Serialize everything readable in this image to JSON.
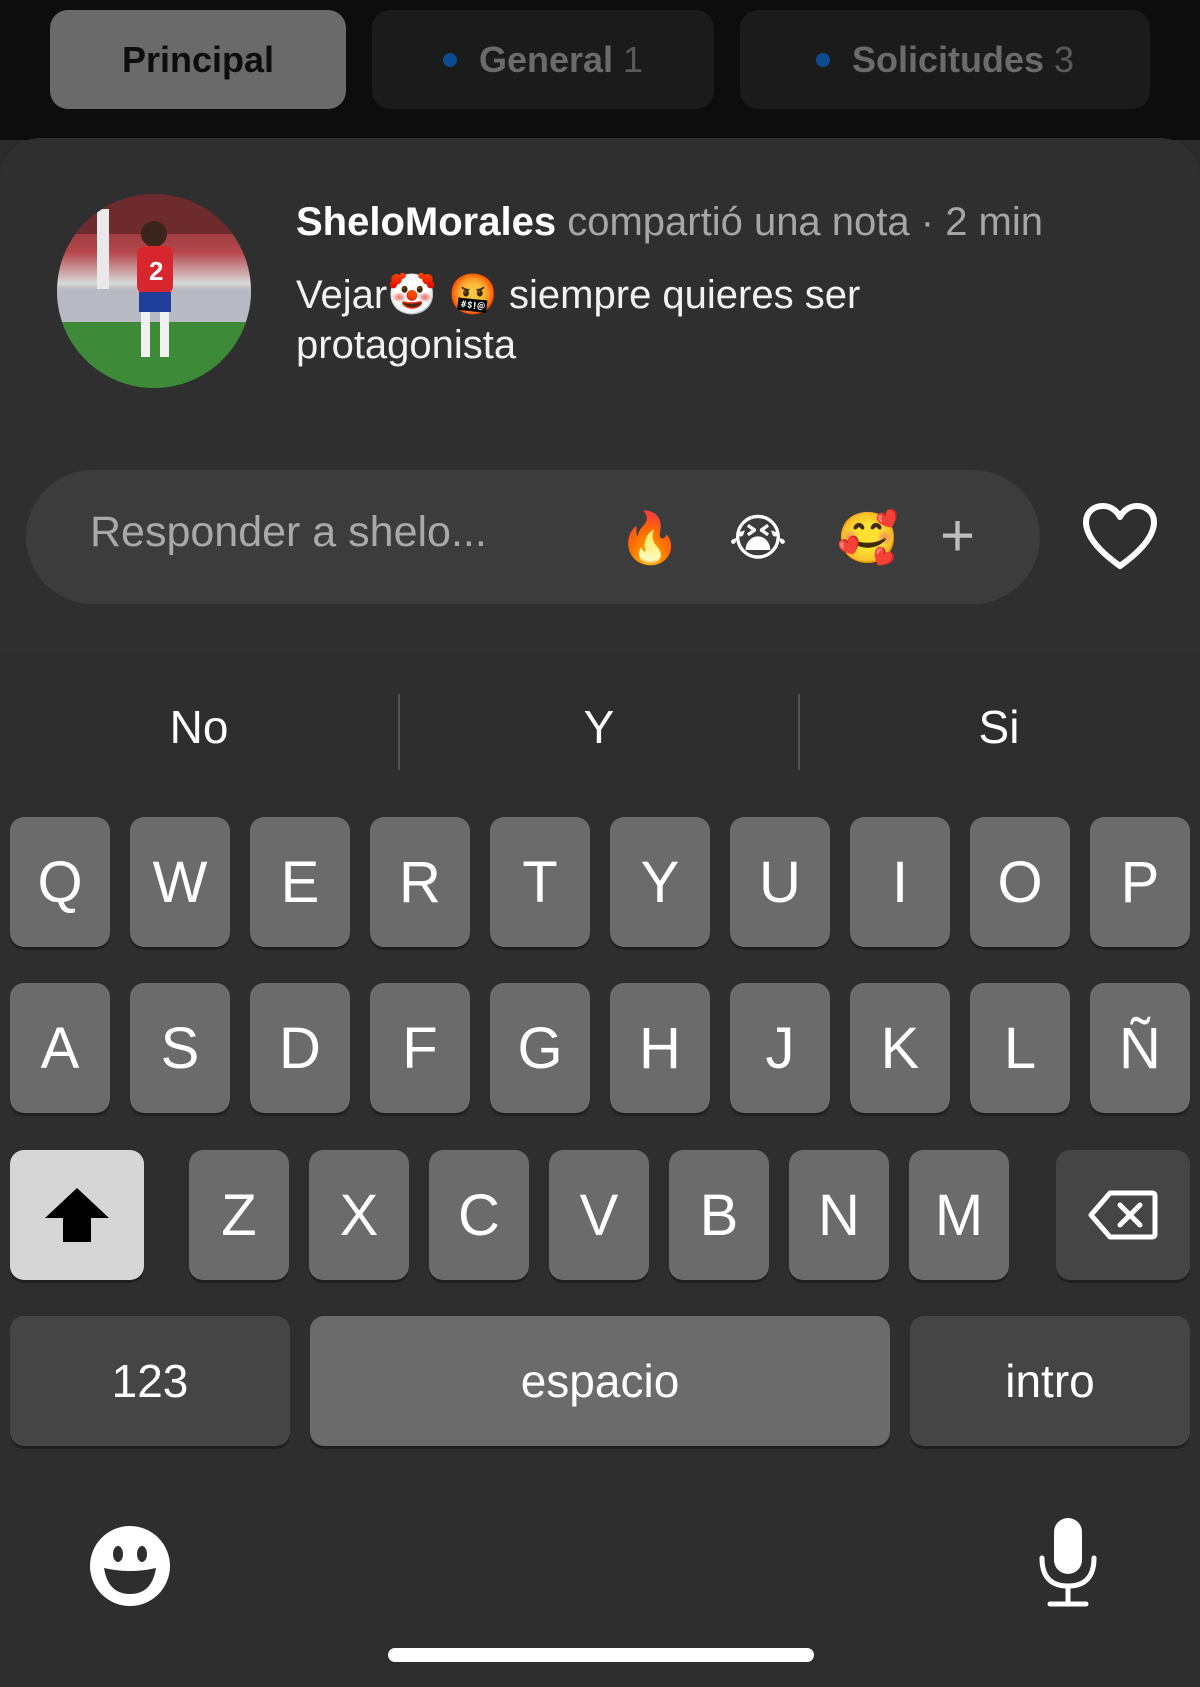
{
  "tabs": [
    {
      "label": "Principal",
      "count": ""
    },
    {
      "label": "General",
      "count": "1"
    },
    {
      "label": "Solicitudes",
      "count": "3"
    }
  ],
  "note": {
    "username": "SheloMorales",
    "meta": "compartió una nota · 2 min",
    "text_prefix": "Vejar",
    "emoji1": "🤡",
    "emoji2": "🤬",
    "text_rest": "siempre quieres ser",
    "text_line2": "protagonista"
  },
  "reply": {
    "placeholder": "Responder a shelo...",
    "reactions": [
      "🔥",
      "😭",
      "🥰"
    ],
    "plus": "+"
  },
  "keyboard": {
    "suggestions": [
      "No",
      "Y",
      "Si"
    ],
    "row1": [
      "Q",
      "W",
      "E",
      "R",
      "T",
      "Y",
      "U",
      "I",
      "O",
      "P"
    ],
    "row2": [
      "A",
      "S",
      "D",
      "F",
      "G",
      "H",
      "J",
      "K",
      "L",
      "Ñ"
    ],
    "row3": [
      "Z",
      "X",
      "C",
      "V",
      "B",
      "N",
      "M"
    ],
    "numbers": "123",
    "space": "espacio",
    "return": "intro"
  },
  "icons": {
    "shift": "shift-arrow-icon",
    "backspace": "backspace-icon",
    "emoji": "emoji-face-icon",
    "mic": "microphone-icon",
    "heart": "heart-outline-icon"
  }
}
